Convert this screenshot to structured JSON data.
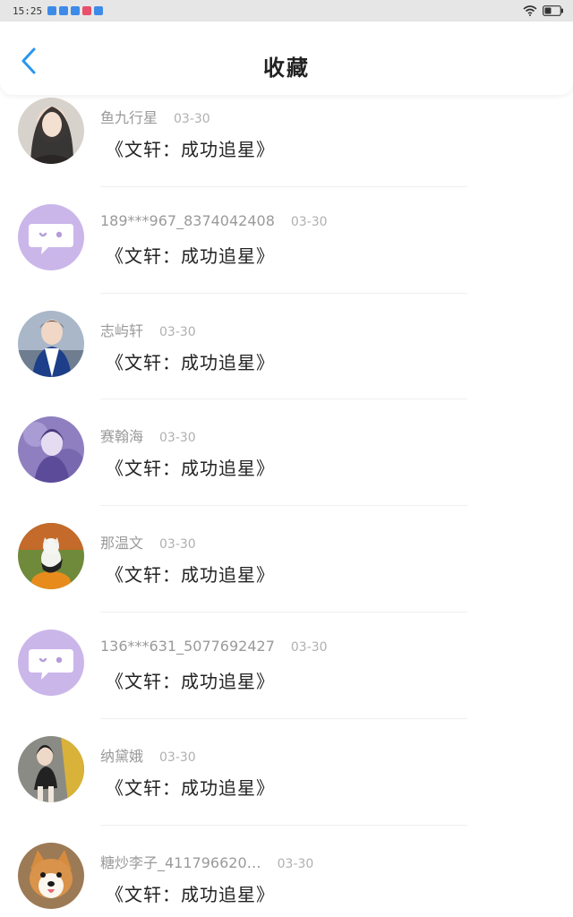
{
  "status_bar": {
    "time": "15:25",
    "notification_icons": [
      {
        "name": "app-notification-icon",
        "color": "#3d8be8"
      },
      {
        "name": "app-notification-icon",
        "color": "#3d8be8"
      },
      {
        "name": "app-notification-icon",
        "color": "#3d8be8"
      },
      {
        "name": "app-notification-icon",
        "color": "#e8506b"
      },
      {
        "name": "app-notification-icon",
        "color": "#3d8be8"
      }
    ],
    "wifi_icon": "wifi-icon",
    "battery_icon": "battery-icon"
  },
  "header": {
    "title": "收藏",
    "back_icon": "chevron-left-icon",
    "accent_color": "#2a96f0"
  },
  "favorites": [
    {
      "username": "鱼九行星",
      "date": "03-30",
      "content": "《文轩：成功追星》",
      "avatar": "photo-avatar"
    },
    {
      "username": "189***967_8374042408",
      "date": "03-30",
      "content": "《文轩：成功追星》",
      "avatar": "default-chat-avatar"
    },
    {
      "username": "志屿轩",
      "date": "03-30",
      "content": "《文轩：成功追星》",
      "avatar": "photo-avatar"
    },
    {
      "username": "赛翰海",
      "date": "03-30",
      "content": "《文轩：成功追星》",
      "avatar": "photo-avatar"
    },
    {
      "username": "那温文",
      "date": "03-30",
      "content": "《文轩：成功追星》",
      "avatar": "photo-avatar"
    },
    {
      "username": "136***631_5077692427",
      "date": "03-30",
      "content": "《文轩：成功追星》",
      "avatar": "default-chat-avatar"
    },
    {
      "username": "纳黛娥",
      "date": "03-30",
      "content": "《文轩：成功追星》",
      "avatar": "photo-avatar"
    },
    {
      "username": "糖炒李子_411796620…",
      "date": "03-30",
      "content": "《文轩：成功追星》",
      "avatar": "photo-avatar"
    }
  ],
  "colors": {
    "default_avatar_bg": "#cbb6ea"
  }
}
